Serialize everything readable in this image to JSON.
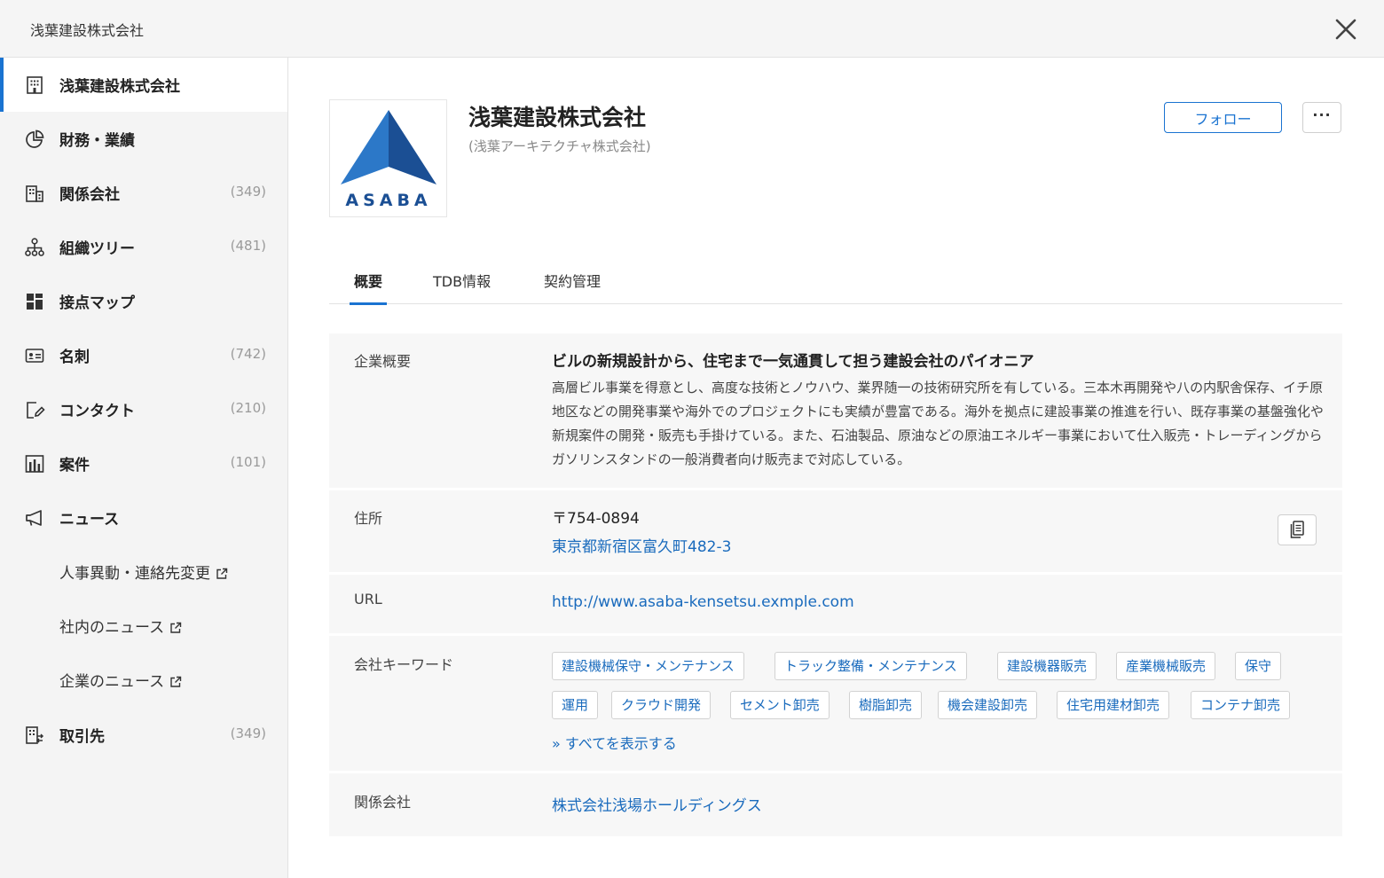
{
  "window": {
    "title": "浅葉建設株式会社"
  },
  "sidebar": {
    "items": [
      {
        "label": "浅葉建設株式会社",
        "count": "",
        "icon": "building-icon"
      },
      {
        "label": "財務・業績",
        "count": "",
        "icon": "pie-chart-icon"
      },
      {
        "label": "関係会社",
        "count": "(349)",
        "icon": "affiliate-icon"
      },
      {
        "label": "組織ツリー",
        "count": "(481)",
        "icon": "org-tree-icon"
      },
      {
        "label": "接点マップ",
        "count": "",
        "icon": "grid-icon"
      },
      {
        "label": "名刺",
        "count": "(742)",
        "icon": "business-card-icon"
      },
      {
        "label": "コンタクト",
        "count": "(210)",
        "icon": "contact-edit-icon"
      },
      {
        "label": "案件",
        "count": "(101)",
        "icon": "deals-icon"
      },
      {
        "label": "ニュース",
        "count": "",
        "icon": "megaphone-icon"
      },
      {
        "label": "人事異動・連絡先変更",
        "count": "",
        "icon": "external-link-icon"
      },
      {
        "label": "社内のニュース",
        "count": "",
        "icon": "external-link-icon"
      },
      {
        "label": "企業のニュース",
        "count": "",
        "icon": "external-link-icon"
      },
      {
        "label": "取引先",
        "count": "(349)",
        "icon": "clients-icon"
      }
    ]
  },
  "company": {
    "logo_text": "ASABA",
    "name": "浅葉建設株式会社",
    "sub_name": "(浅葉アーキテクチャ株式会社)",
    "follow_label": "フォロー",
    "more_label": "···"
  },
  "tabs": [
    {
      "label": "概要",
      "active": true
    },
    {
      "label": "TDB情報",
      "active": false
    },
    {
      "label": "契約管理",
      "active": false
    }
  ],
  "overview": {
    "summary_label": "企業概要",
    "headline": "ビルの新規設計から、住宅まで一気通貫して担う建設会社のパイオニア",
    "description": "高層ビル事業を得意とし、高度な技術とノウハウ、業界随一の技術研究所を有している。三本木再開発や八の内駅舎保存、イチ原地区などの開発事業や海外でのプロジェクトにも実績が豊富である。海外を拠点に建設事業の推進を行い、既存事業の基盤強化や新規案件の開発・販売も手掛けている。また、石油製品、原油などの原油エネルギー事業において仕入販売・トレーディングからガソリンスタンドの一般消費者向け販売まで対応している。",
    "address_label": "住所",
    "postal": "〒754-0894",
    "address": "東京都新宿区富久町482-3",
    "url_label": "URL",
    "url": "http://www.asaba-kensetsu.exmple.com",
    "keywords_label": "会社キーワード",
    "keywords": [
      "建設機械保守・メンテナンス",
      "トラック整備・メンテナンス",
      "建設機器販売",
      "産業機械販売",
      "保守",
      "運用",
      "クラウド開発",
      "セメント卸売",
      "樹脂卸売",
      "機会建設卸売",
      "住宅用建材卸売",
      "コンテナ卸売"
    ],
    "show_all": "» すべてを表示する",
    "related_label": "関係会社",
    "related_company": "株式会社浅場ホールディングス"
  },
  "colors": {
    "accent": "#1a73d1",
    "link": "#1a6bbd",
    "logo_dark": "#1b4f94",
    "logo_light": "#2c78c8"
  }
}
